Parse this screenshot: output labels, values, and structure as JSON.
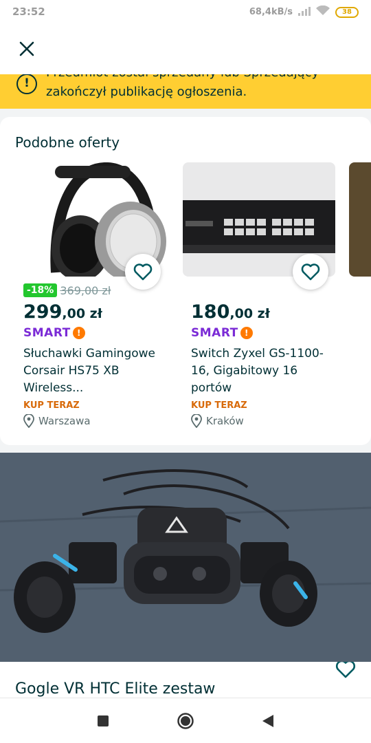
{
  "status_bar": {
    "time": "23:52",
    "net_speed": "68,4kB/s",
    "battery": "38"
  },
  "header": {
    "close_icon": "close-icon"
  },
  "alert": {
    "line1": "Przedmiot został sprzedany lub Sprzedający",
    "line2": "zakończył publikację ogłoszenia.",
    "icon": "info-icon"
  },
  "similar": {
    "title": "Podobne oferty",
    "offers": [
      {
        "discount": "-18%",
        "old_price": "369,00 zł",
        "price_main": "299",
        "price_cents": ",00 zł",
        "smart_label": "SMART",
        "smart_badge": "!",
        "title": "Słuchawki Gamingowe Corsair HS75 XB Wireless...",
        "buy_now": "KUP TERAZ",
        "location": "Warszawa",
        "image_icon": "headphones-image"
      },
      {
        "price_main": "180",
        "price_cents": ",00 zł",
        "smart_label": "SMART",
        "smart_badge": "!",
        "title": "Switch Zyxel GS-1100-16, Gigabitowy 16 portów",
        "buy_now": "KUP TERAZ",
        "location": "Kraków",
        "image_icon": "network-switch-image"
      }
    ]
  },
  "listing": {
    "title": "Gogle VR HTC Elite zestaw",
    "image_icon": "vr-headset-photo"
  },
  "nav": {
    "recents_icon": "square-icon",
    "home_icon": "circle-icon",
    "back_icon": "triangle-back-icon"
  },
  "colors": {
    "alert_bg": "#ffce32",
    "discount_green": "#23c72e",
    "smart_purple": "#7b2bd6",
    "buy_now_orange": "#d86a0a",
    "fav_teal": "#23e5db",
    "text_dark": "#002f34"
  }
}
